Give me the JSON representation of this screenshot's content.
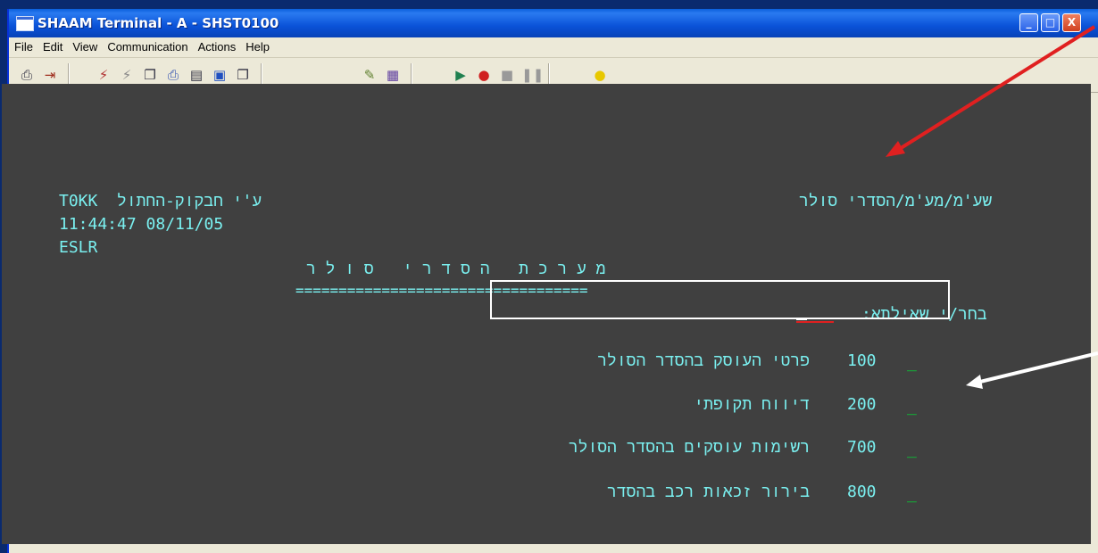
{
  "window": {
    "title": "SHAAM Terminal - A - SHST0100",
    "controls": [
      "_",
      "□",
      "X"
    ]
  },
  "menubar": {
    "items": [
      "File",
      "Edit",
      "View",
      "Communication",
      "Actions",
      "Help"
    ]
  },
  "toolbar": {
    "icons": [
      "print-icon",
      "exit-icon",
      "connect-icon",
      "disconnect-icon",
      "copy-icon",
      "print-screen-icon",
      "paste-icon",
      "select-all-icon",
      "transfer-icon",
      "macro-icon",
      "keypad-icon",
      "play-macro-icon",
      "record-macro-icon",
      "stop-macro-icon",
      "pause-macro-icon",
      "hint-icon"
    ]
  },
  "terminal": {
    "header_right": "שע'מ/מע'מ/הסדרי סולר",
    "header_left": "T0KK  ע'י חבקוק-החתול",
    "time_date": "11:44:47 08/11/05",
    "session": "ESLR",
    "system_title": "מ ע ר כ ת   ה ס ד ר י   ס ו ל ר",
    "underline": "==================================",
    "prompt": "בחר/י שאילתא:",
    "menu_options": [
      {
        "code": "100",
        "label": "פרטי העוסק בהסדר הסולר",
        "marker": "_"
      },
      {
        "code": "200",
        "label": "דיווח תקופתי",
        "marker": "_"
      },
      {
        "code": "700",
        "label": "רשימות עוסקים בהסדר הסולר",
        "marker": "_"
      },
      {
        "code": "800",
        "label": "בירור זכאות רכב בהסדר",
        "marker": "_"
      }
    ]
  },
  "colors": {
    "terminal_bg": "#404040",
    "terminal_text": "#7af0f0",
    "cursor_marker": "#00dd33",
    "arrow_red": "#e02020",
    "arrow_white": "#ffffff"
  }
}
